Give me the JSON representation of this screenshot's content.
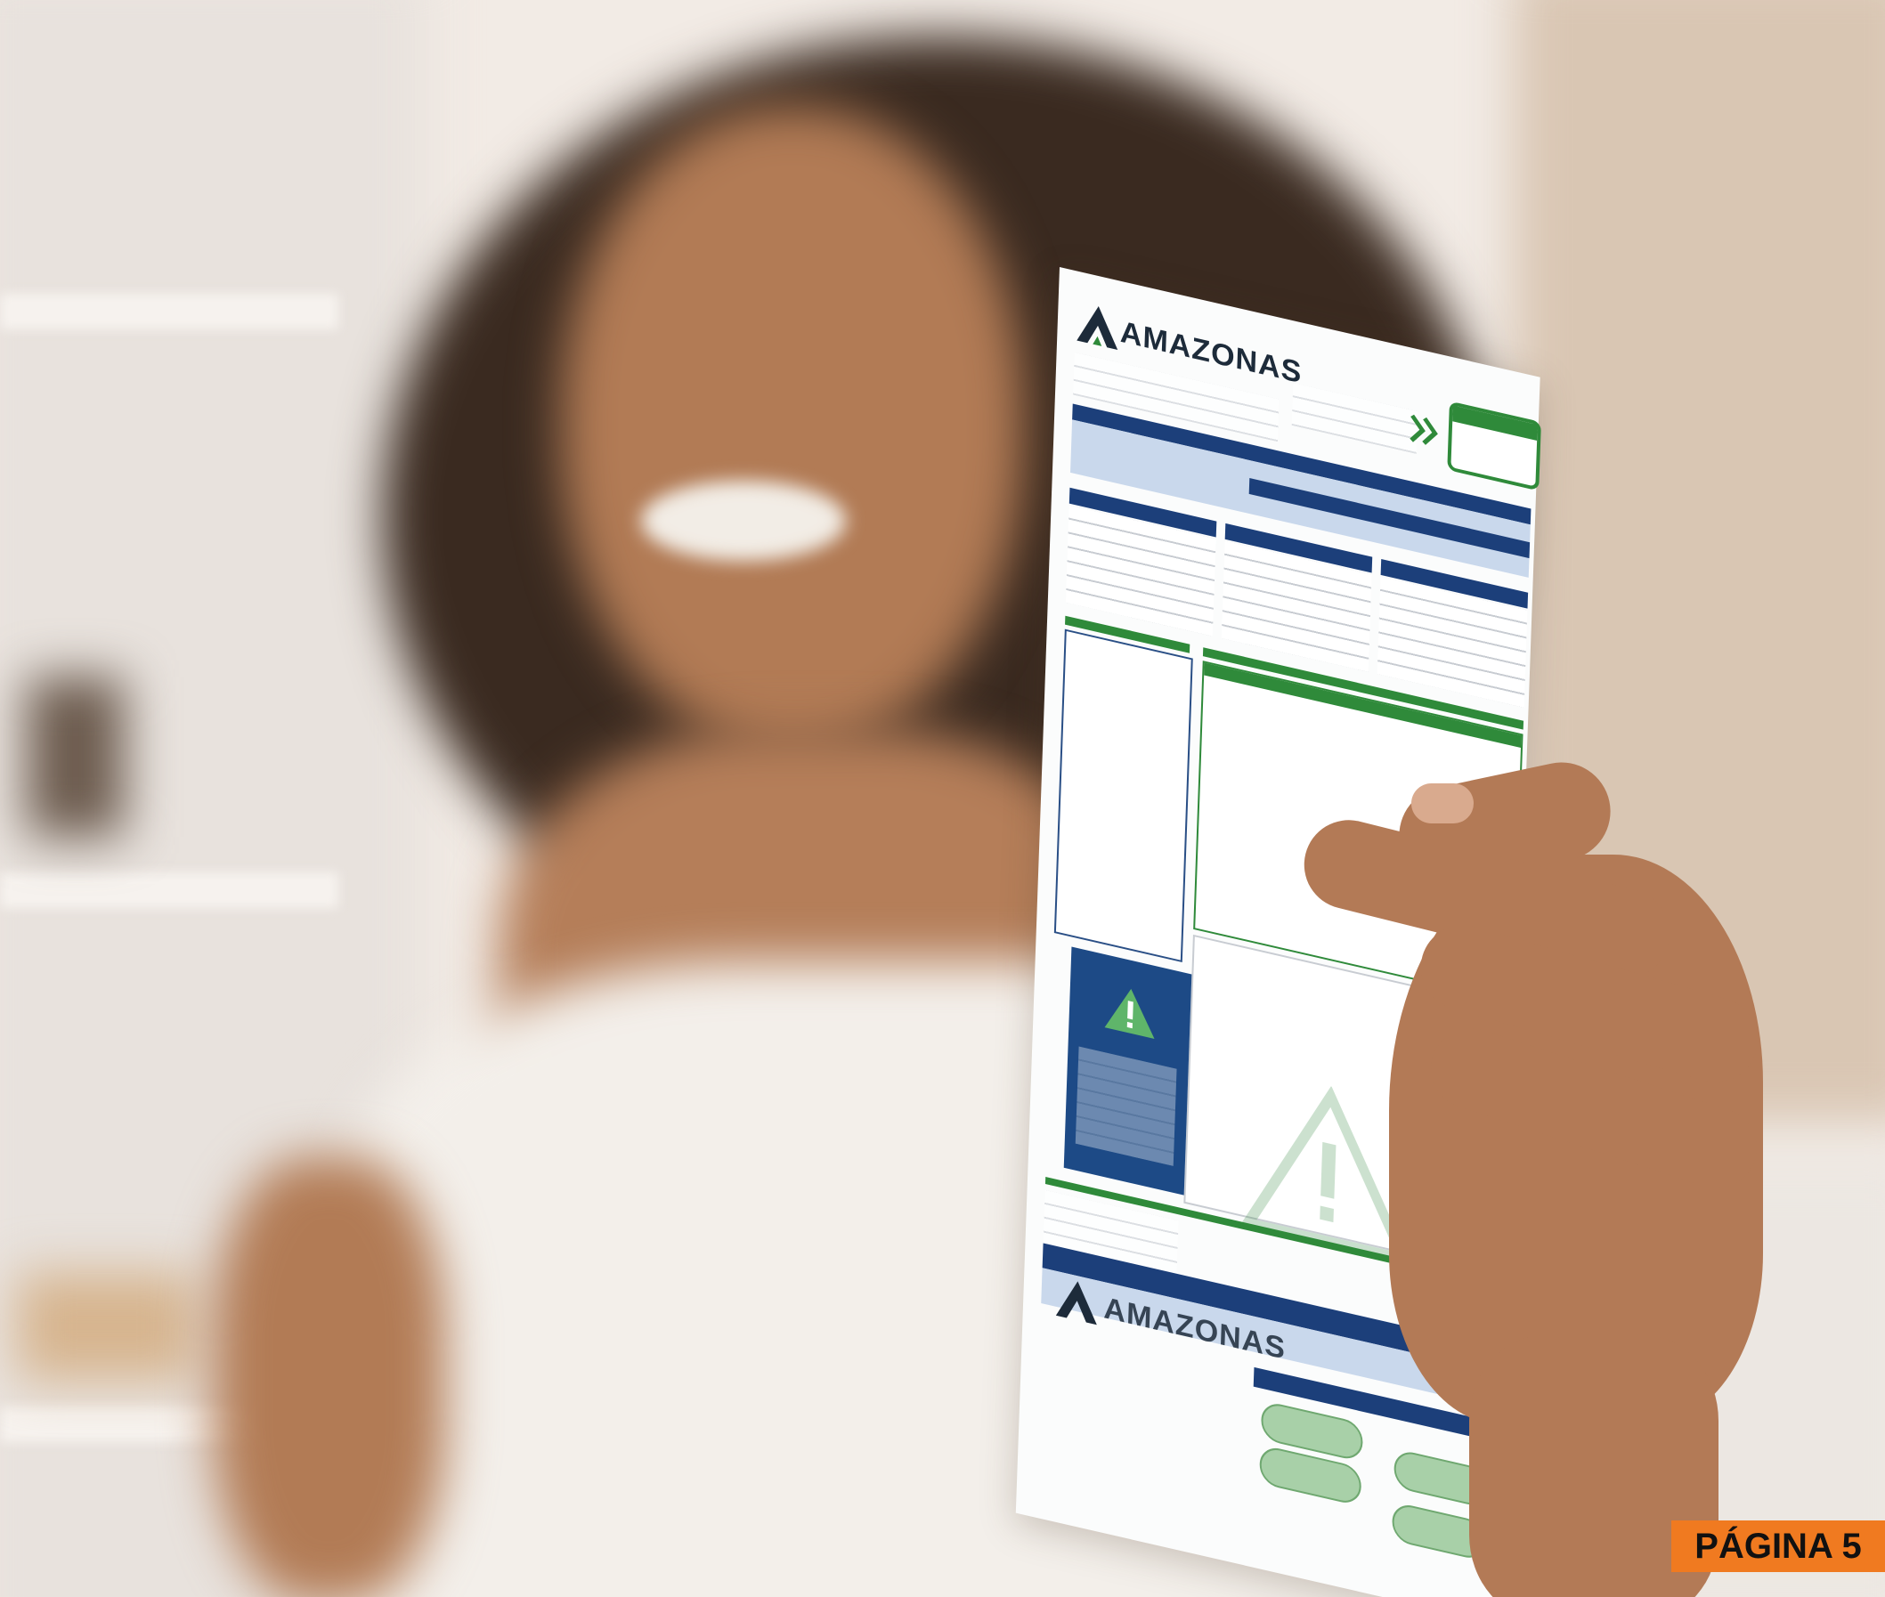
{
  "bill": {
    "brand": "AMAZONAS"
  },
  "badge": {
    "label": "PÁGINA 5"
  },
  "colors": {
    "badge_bg": "#f07a20",
    "bill_blue": "#1c3f7a",
    "bill_green": "#2f8a3a"
  }
}
